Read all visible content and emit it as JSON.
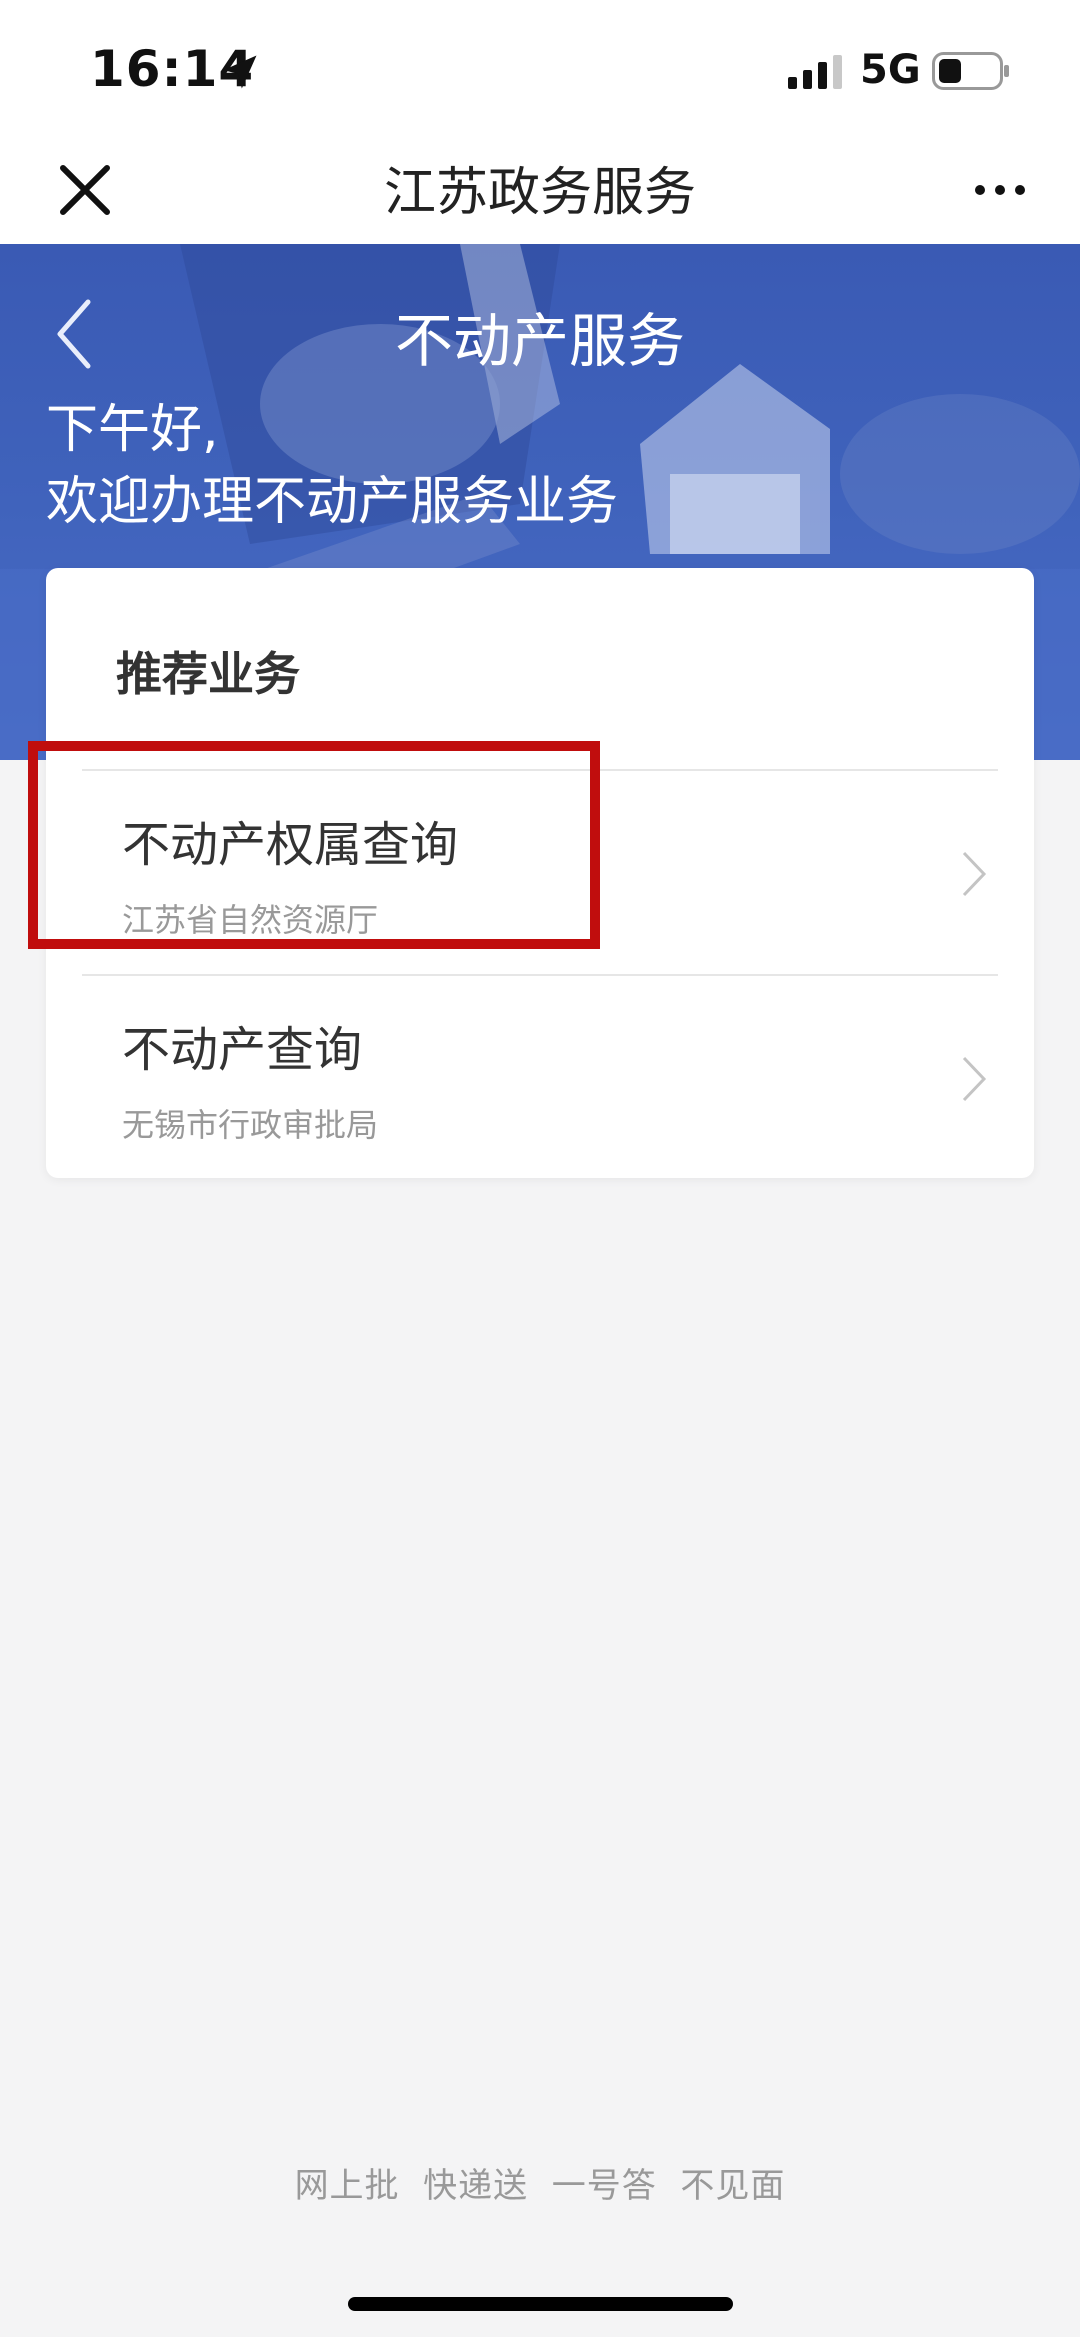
{
  "status_bar": {
    "time": "16:14",
    "network": "5G",
    "icons": [
      "location-arrow-icon",
      "signal-bars-icon",
      "battery-icon"
    ]
  },
  "nav": {
    "title": "江苏政务服务",
    "close_icon": "close-icon",
    "more_icon": "more-icon"
  },
  "banner": {
    "title": "不动产服务",
    "greeting_line1": "下午好,",
    "greeting_line2": "欢迎办理不动产服务业务",
    "back_icon": "back-chevron-icon"
  },
  "recommended": {
    "title": "推荐业务",
    "items": [
      {
        "name": "不动产权属查询",
        "dept": "江苏省自然资源厅",
        "highlighted": true
      },
      {
        "name": "不动产查询",
        "dept": "无锡市行政审批局",
        "highlighted": false
      }
    ]
  },
  "footer": {
    "slogan": "网上批  快递送  一号答  不见面"
  },
  "colors": {
    "banner_blue": "#3f62bb",
    "highlight_red": "#c00d0d",
    "background": "#f4f4f5"
  }
}
